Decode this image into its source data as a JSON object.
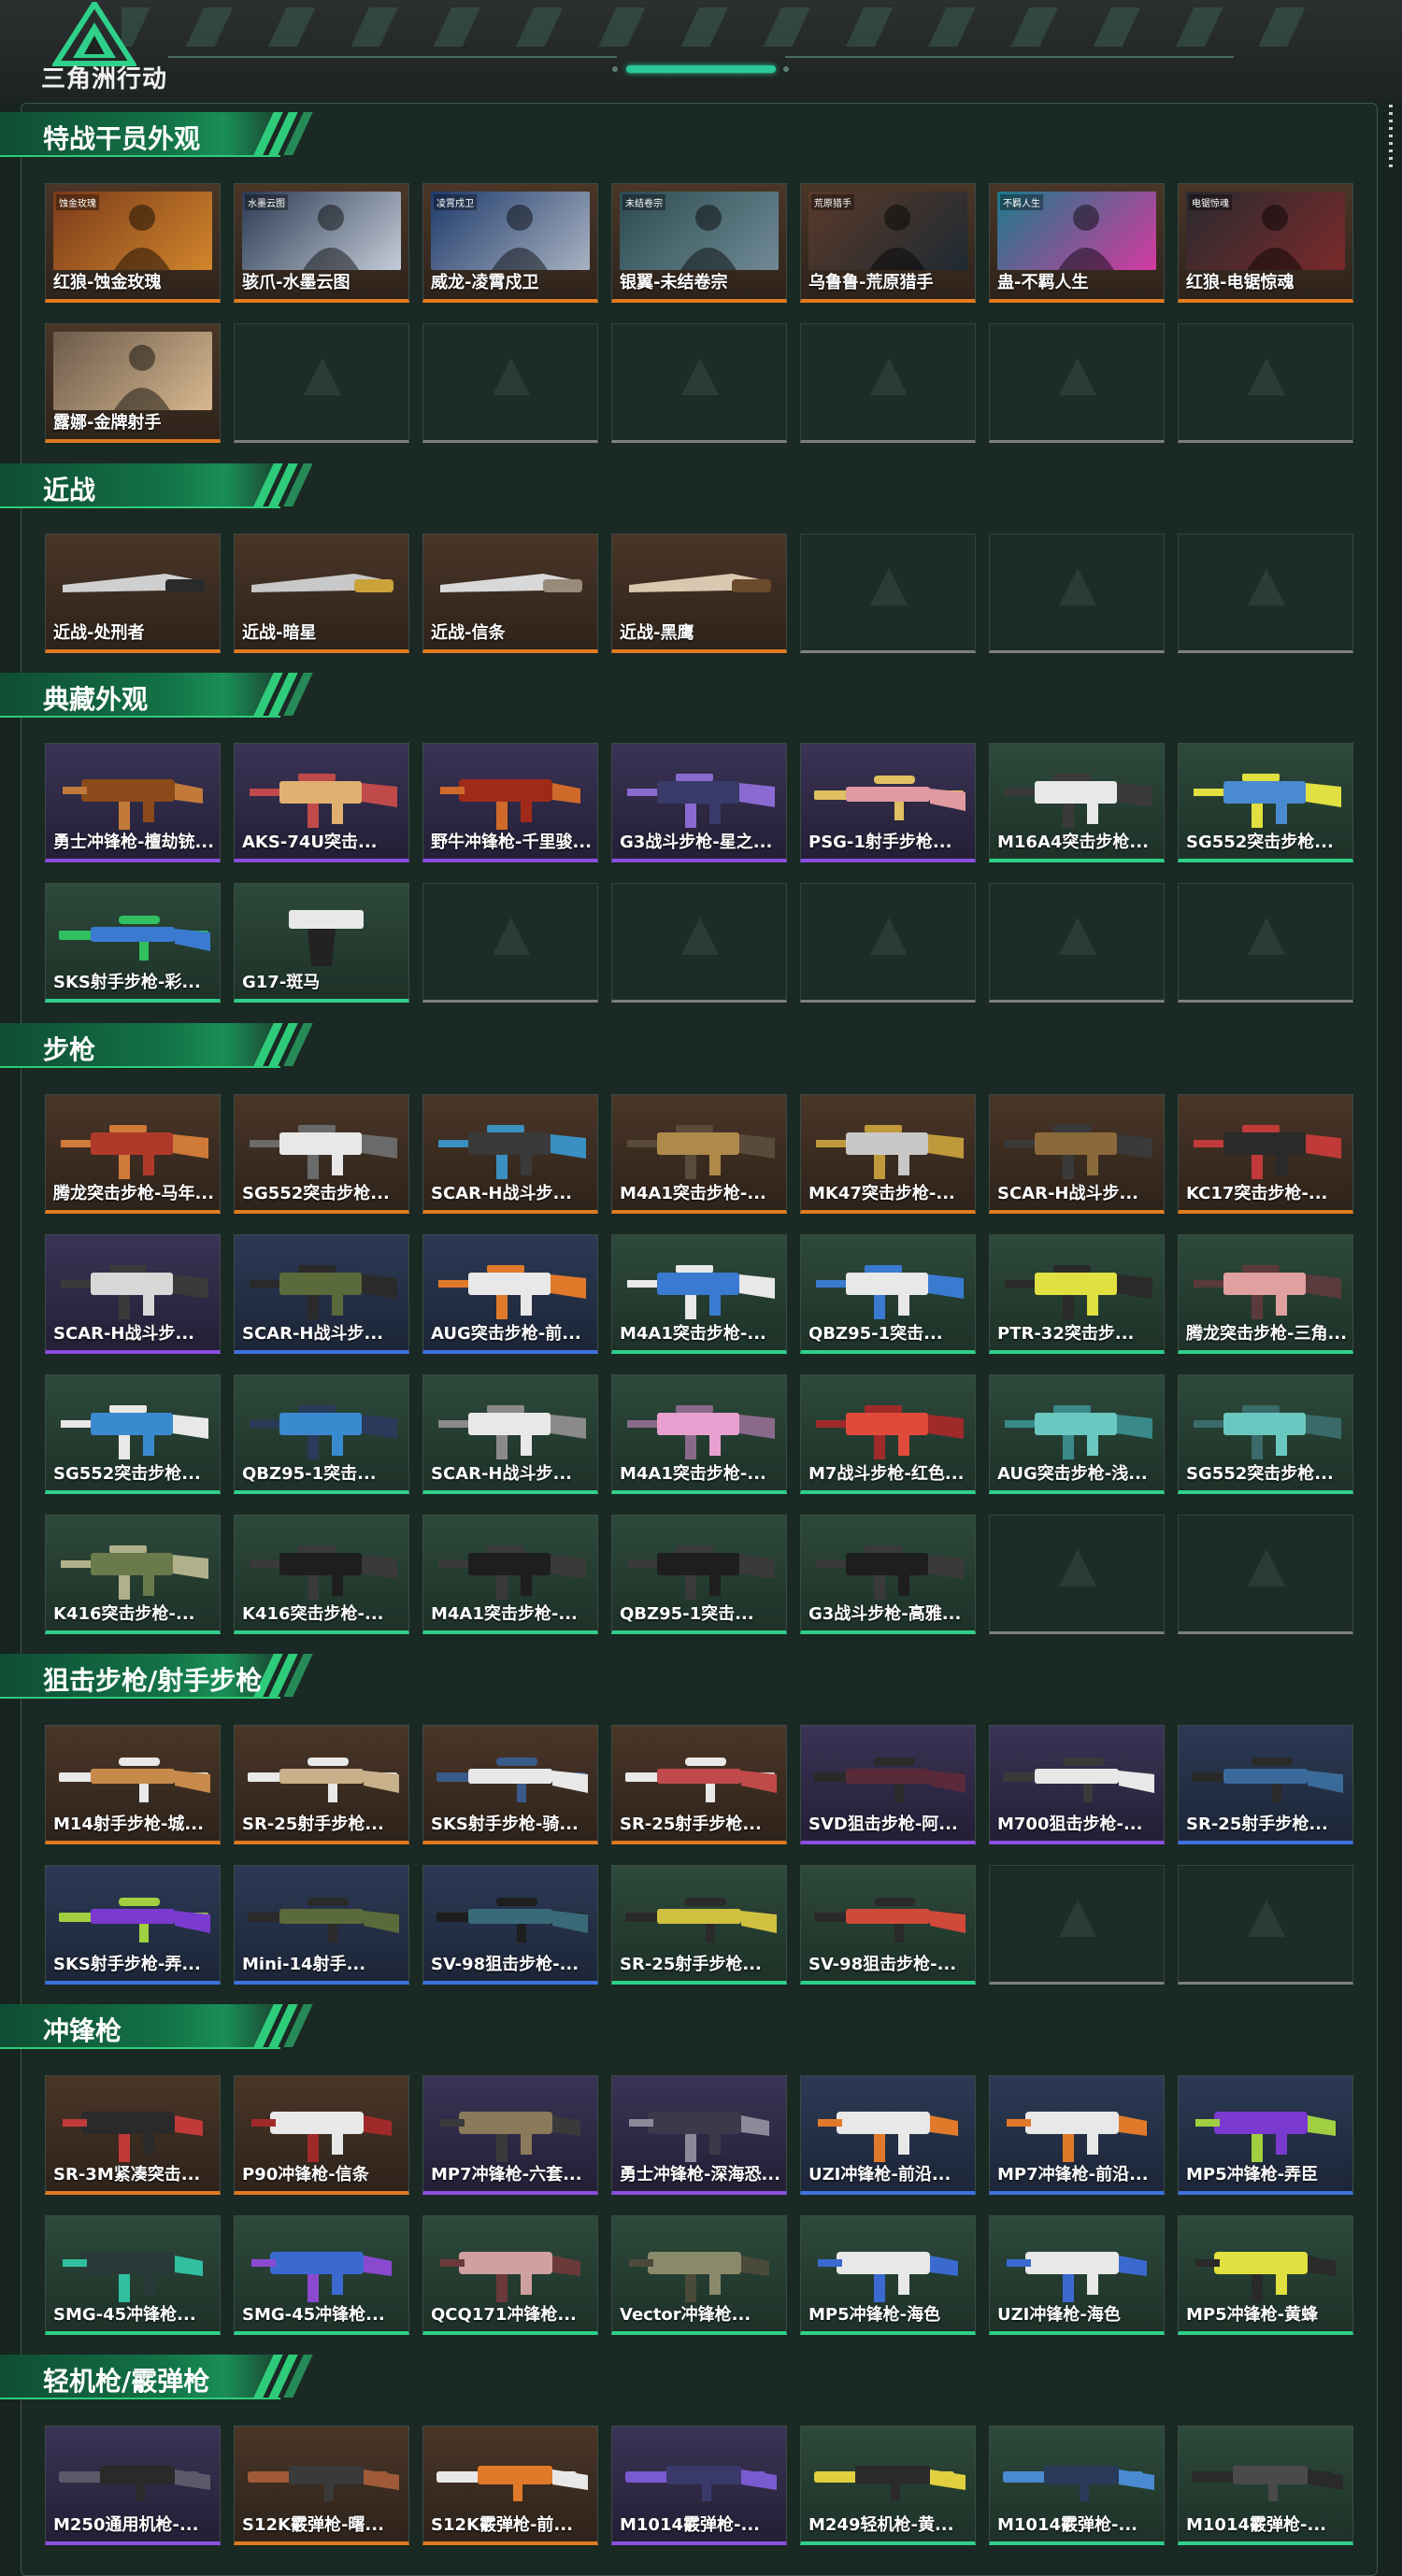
{
  "app": {
    "title": "三角洲行动"
  },
  "sections": [
    {
      "id": "operators",
      "title": "特战干员外观",
      "items": [
        {
          "label": "红狼-蚀金玫瑰",
          "rarity": "orange",
          "icon": "operator-portrait",
          "tag": "蚀金玫瑰",
          "colors": [
            "#7a3a1a",
            "#d2862c"
          ]
        },
        {
          "label": "骇爪-水墨云图",
          "rarity": "orange",
          "icon": "operator-portrait",
          "tag": "水墨云图",
          "colors": [
            "#2b3a52",
            "#c4ccd8"
          ]
        },
        {
          "label": "威龙-凌霄戍卫",
          "rarity": "orange",
          "icon": "operator-portrait",
          "tag": "凌霄戍卫",
          "colors": [
            "#1f3b6b",
            "#a8b2c2"
          ]
        },
        {
          "label": "银翼-未结卷宗",
          "rarity": "orange",
          "icon": "operator-portrait",
          "tag": "未结卷宗",
          "colors": [
            "#2d4a52",
            "#6f8a94"
          ]
        },
        {
          "label": "乌鲁鲁-荒原猎手",
          "rarity": "orange",
          "icon": "operator-portrait",
          "tag": "荒原猎手",
          "colors": [
            "#5a3a2a",
            "#1f2a33"
          ]
        },
        {
          "label": "蛊-不羁人生",
          "rarity": "orange",
          "icon": "operator-portrait",
          "tag": "不羁人生",
          "colors": [
            "#1c7a8a",
            "#d43aa0"
          ]
        },
        {
          "label": "红狼-电锯惊魂",
          "rarity": "orange",
          "icon": "operator-portrait",
          "tag": "电锯惊魂",
          "colors": [
            "#2a2a30",
            "#7a2a2a"
          ]
        },
        {
          "label": "露娜-金牌射手",
          "rarity": "orange",
          "icon": "operator-portrait",
          "tag": "",
          "colors": [
            "#6b5a4a",
            "#d8b890"
          ]
        },
        {
          "empty": true
        },
        {
          "empty": true
        },
        {
          "empty": true
        },
        {
          "empty": true
        },
        {
          "empty": true
        },
        {
          "empty": true
        }
      ]
    },
    {
      "id": "melee",
      "title": "近战",
      "items": [
        {
          "label": "近战-处刑者",
          "rarity": "orange",
          "icon": "knife-icon",
          "colors": [
            "#cfcfcf",
            "#2a2a2a"
          ]
        },
        {
          "label": "近战-暗星",
          "rarity": "orange",
          "icon": "knife-icon",
          "colors": [
            "#c8c8c8",
            "#c9a23a"
          ]
        },
        {
          "label": "近战-信条",
          "rarity": "orange",
          "icon": "knife-icon",
          "colors": [
            "#d8d8d8",
            "#9a8a7a"
          ]
        },
        {
          "label": "近战-黑鹰",
          "rarity": "orange",
          "icon": "knife-icon",
          "colors": [
            "#d8c8b0",
            "#6a4a2a"
          ]
        },
        {
          "empty": true
        },
        {
          "empty": true
        },
        {
          "empty": true
        }
      ]
    },
    {
      "id": "collection",
      "title": "典藏外观",
      "items": [
        {
          "label": "勇士冲锋枪-檀劫铳...",
          "rarity": "purple",
          "icon": "smg-icon",
          "colors": [
            "#8a4a1a",
            "#c27a3a"
          ]
        },
        {
          "label": "AKS-74U突击...",
          "rarity": "purple",
          "icon": "rifle-icon",
          "colors": [
            "#e0b070",
            "#c04a4a"
          ]
        },
        {
          "label": "野牛冲锋枪-千里骏...",
          "rarity": "purple",
          "icon": "smg-icon",
          "colors": [
            "#a02a1a",
            "#d06a2a"
          ]
        },
        {
          "label": "G3战斗步枪-星之...",
          "rarity": "purple",
          "icon": "rifle-icon",
          "colors": [
            "#3a3a6a",
            "#8a6ad0"
          ]
        },
        {
          "label": "PSG-1射手步枪...",
          "rarity": "purple",
          "icon": "sniper-icon",
          "colors": [
            "#e09aa0",
            "#e0c060"
          ]
        },
        {
          "label": "M16A4突击步枪...",
          "rarity": "green",
          "icon": "rifle-icon",
          "colors": [
            "#e8e8e8",
            "#3a3a3a"
          ]
        },
        {
          "label": "SG552突击步枪...",
          "rarity": "green",
          "icon": "rifle-icon",
          "colors": [
            "#4a8ad0",
            "#e0e040"
          ]
        },
        {
          "label": "SKS射手步枪-彩...",
          "rarity": "green",
          "icon": "sniper-icon",
          "colors": [
            "#3a7ad0",
            "#30c060"
          ]
        },
        {
          "label": "G17-斑马",
          "rarity": "green",
          "icon": "pistol-icon",
          "colors": [
            "#e8e8e8",
            "#222222"
          ]
        },
        {
          "empty": true
        },
        {
          "empty": true
        },
        {
          "empty": true
        },
        {
          "empty": true
        },
        {
          "empty": true
        }
      ]
    },
    {
      "id": "rifles",
      "title": "步枪",
      "items": [
        {
          "label": "腾龙突击步枪-马年...",
          "rarity": "orange",
          "icon": "rifle-icon",
          "colors": [
            "#b03a2a",
            "#d07a3a"
          ]
        },
        {
          "label": "SG552突击步枪...",
          "rarity": "orange",
          "icon": "rifle-icon",
          "colors": [
            "#e8e8e8",
            "#6a6a6a"
          ]
        },
        {
          "label": "SCAR-H战斗步...",
          "rarity": "orange",
          "icon": "rifle-icon",
          "colors": [
            "#3a3a3a",
            "#3a90c0"
          ]
        },
        {
          "label": "M4A1突击步枪-...",
          "rarity": "orange",
          "icon": "rifle-icon",
          "colors": [
            "#b08a4a",
            "#5a4a3a"
          ]
        },
        {
          "label": "MK47突击步枪-...",
          "rarity": "orange",
          "icon": "rifle-icon",
          "colors": [
            "#c8c8c8",
            "#c09a3a"
          ]
        },
        {
          "label": "SCAR-H战斗步...",
          "rarity": "orange",
          "icon": "rifle-icon",
          "colors": [
            "#8a6a3a",
            "#3a3a3a"
          ]
        },
        {
          "label": "KC17突击步枪-...",
          "rarity": "orange",
          "icon": "rifle-icon",
          "colors": [
            "#2a2a2a",
            "#c03a3a"
          ]
        },
        {
          "label": "SCAR-H战斗步...",
          "rarity": "purple",
          "icon": "rifle-icon",
          "colors": [
            "#d8d8d8",
            "#3a3a3a"
          ]
        },
        {
          "label": "SCAR-H战斗步...",
          "rarity": "blue",
          "icon": "rifle-icon",
          "colors": [
            "#5a6a3a",
            "#2a2a2a"
          ]
        },
        {
          "label": "AUG突击步枪-前...",
          "rarity": "blue",
          "icon": "rifle-icon",
          "colors": [
            "#e8e8e8",
            "#e07a2a"
          ]
        },
        {
          "label": "M4A1突击步枪-...",
          "rarity": "green",
          "icon": "rifle-icon",
          "colors": [
            "#3a7ad0",
            "#e8e8e8"
          ]
        },
        {
          "label": "QBZ95-1突击...",
          "rarity": "green",
          "icon": "rifle-icon",
          "colors": [
            "#e8e8e8",
            "#3a7ad0"
          ]
        },
        {
          "label": "PTR-32突击步...",
          "rarity": "green",
          "icon": "rifle-icon",
          "colors": [
            "#e0e040",
            "#2a2a2a"
          ]
        },
        {
          "label": "腾龙突击步枪-三角...",
          "rarity": "green",
          "icon": "rifle-icon",
          "colors": [
            "#e0a0a0",
            "#5a3a3a"
          ]
        },
        {
          "label": "SG552突击步枪...",
          "rarity": "green",
          "icon": "rifle-icon",
          "colors": [
            "#3a8ad0",
            "#e8e8e8"
          ]
        },
        {
          "label": "QBZ95-1突击...",
          "rarity": "green",
          "icon": "rifle-icon",
          "colors": [
            "#3a8ad0",
            "#2a3a5a"
          ]
        },
        {
          "label": "SCAR-H战斗步...",
          "rarity": "green",
          "icon": "rifle-icon",
          "colors": [
            "#e8e8e8",
            "#8a8a8a"
          ]
        },
        {
          "label": "M4A1突击步枪-...",
          "rarity": "green",
          "icon": "rifle-icon",
          "colors": [
            "#e8a0d0",
            "#8a6a8a"
          ]
        },
        {
          "label": "M7战斗步枪-红色...",
          "rarity": "green",
          "icon": "rifle-icon",
          "colors": [
            "#e04a3a",
            "#a02a2a"
          ]
        },
        {
          "label": "AUG突击步枪-浅...",
          "rarity": "green",
          "icon": "rifle-icon",
          "colors": [
            "#6ac8c0",
            "#3a8a8a"
          ]
        },
        {
          "label": "SG552突击步枪...",
          "rarity": "green",
          "icon": "rifle-icon",
          "colors": [
            "#6ac8c0",
            "#3a6a6a"
          ]
        },
        {
          "label": "K416突击步枪-...",
          "rarity": "green",
          "icon": "rifle-icon",
          "colors": [
            "#6a7a4a",
            "#b0b08a"
          ]
        },
        {
          "label": "K416突击步枪-...",
          "rarity": "green",
          "icon": "rifle-icon",
          "colors": [
            "#1e1e1e",
            "#3a3a3a"
          ]
        },
        {
          "label": "M4A1突击步枪-...",
          "rarity": "green",
          "icon": "rifle-icon",
          "colors": [
            "#1e1e1e",
            "#3a3a3a"
          ]
        },
        {
          "label": "QBZ95-1突击...",
          "rarity": "green",
          "icon": "rifle-icon",
          "colors": [
            "#1e1e1e",
            "#3a3a3a"
          ]
        },
        {
          "label": "G3战斗步枪-高雅...",
          "rarity": "green",
          "icon": "rifle-icon",
          "colors": [
            "#1e1e1e",
            "#3a3a3a"
          ]
        },
        {
          "empty": true
        },
        {
          "empty": true
        }
      ]
    },
    {
      "id": "marksman",
      "title": "狙击步枪/射手步枪",
      "items": [
        {
          "label": "M14射手步枪-城...",
          "rarity": "orange",
          "icon": "sniper-icon",
          "colors": [
            "#c88a4a",
            "#e8e8e8"
          ]
        },
        {
          "label": "SR-25射手步枪...",
          "rarity": "orange",
          "icon": "sniper-icon",
          "colors": [
            "#c8b08a",
            "#e8e8e8"
          ]
        },
        {
          "label": "SKS射手步枪-骑...",
          "rarity": "orange",
          "icon": "sniper-icon",
          "colors": [
            "#e8e8e8",
            "#3a5a8a"
          ]
        },
        {
          "label": "SR-25射手步枪...",
          "rarity": "orange",
          "icon": "sniper-icon",
          "colors": [
            "#c04a4a",
            "#e8e8e8"
          ]
        },
        {
          "label": "SVD狙击步枪-阿...",
          "rarity": "purple",
          "icon": "sniper-icon",
          "colors": [
            "#5a2a3a",
            "#2a2a2a"
          ]
        },
        {
          "label": "M700狙击步枪-...",
          "rarity": "purple",
          "icon": "sniper-icon",
          "colors": [
            "#e8e8e8",
            "#3a3a3a"
          ]
        },
        {
          "label": "SR-25射手步枪...",
          "rarity": "blue",
          "icon": "sniper-icon",
          "colors": [
            "#3a6a9a",
            "#2a2a2a"
          ]
        },
        {
          "label": "SKS射手步枪-弄...",
          "rarity": "blue",
          "icon": "sniper-icon",
          "colors": [
            "#7a3ad0",
            "#a0d040"
          ]
        },
        {
          "label": "Mini-14射手...",
          "rarity": "blue",
          "icon": "sniper-icon",
          "colors": [
            "#5a6a3a",
            "#2a2a2a"
          ]
        },
        {
          "label": "SV-98狙击步枪-...",
          "rarity": "blue",
          "icon": "sniper-icon",
          "colors": [
            "#3a6a7a",
            "#1e1e1e"
          ]
        },
        {
          "label": "SR-25射手步枪...",
          "rarity": "green",
          "icon": "sniper-icon",
          "colors": [
            "#d0c040",
            "#2a2a2a"
          ]
        },
        {
          "label": "SV-98狙击步枪-...",
          "rarity": "green",
          "icon": "sniper-icon",
          "colors": [
            "#d04a3a",
            "#2a2a2a"
          ]
        },
        {
          "empty": true
        },
        {
          "empty": true
        }
      ]
    },
    {
      "id": "smg",
      "title": "冲锋枪",
      "items": [
        {
          "label": "SR-3M紧凑突击...",
          "rarity": "orange",
          "icon": "smg-icon",
          "colors": [
            "#2a2a2a",
            "#c03a3a"
          ]
        },
        {
          "label": "P90冲锋枪-信条",
          "rarity": "orange",
          "icon": "smg-icon",
          "colors": [
            "#e8e8e8",
            "#a02a2a"
          ]
        },
        {
          "label": "MP7冲锋枪-六套...",
          "rarity": "purple",
          "icon": "smg-icon",
          "colors": [
            "#8a7a5a",
            "#3a3a3a"
          ]
        },
        {
          "label": "勇士冲锋枪-深海恐...",
          "rarity": "purple",
          "icon": "smg-icon",
          "colors": [
            "#3a3a4a",
            "#8a8a9a"
          ]
        },
        {
          "label": "UZI冲锋枪-前沿...",
          "rarity": "blue",
          "icon": "smg-icon",
          "colors": [
            "#e8e8e8",
            "#e07a2a"
          ]
        },
        {
          "label": "MP7冲锋枪-前沿...",
          "rarity": "blue",
          "icon": "smg-icon",
          "colors": [
            "#e8e8e8",
            "#e07a2a"
          ]
        },
        {
          "label": "MP5冲锋枪-弄臣",
          "rarity": "blue",
          "icon": "smg-icon",
          "colors": [
            "#7a3ad0",
            "#a0d040"
          ]
        },
        {
          "label": "SMG-45冲锋枪...",
          "rarity": "green",
          "icon": "smg-icon",
          "colors": [
            "#2a3a3a",
            "#30c0a0"
          ]
        },
        {
          "label": "SMG-45冲锋枪...",
          "rarity": "green",
          "icon": "smg-icon",
          "colors": [
            "#3a6ad0",
            "#8a4ad0"
          ]
        },
        {
          "label": "QCQ171冲锋枪...",
          "rarity": "green",
          "icon": "smg-icon",
          "colors": [
            "#d0a0a0",
            "#6a3a3a"
          ]
        },
        {
          "label": "Vector冲锋枪...",
          "rarity": "green",
          "icon": "smg-icon",
          "colors": [
            "#8a8a6a",
            "#4a4a3a"
          ]
        },
        {
          "label": "MP5冲锋枪-海色",
          "rarity": "green",
          "icon": "smg-icon",
          "colors": [
            "#e8e8e8",
            "#3a6ad0"
          ]
        },
        {
          "label": "UZI冲锋枪-海色",
          "rarity": "green",
          "icon": "smg-icon",
          "colors": [
            "#e8e8e8",
            "#3a6ad0"
          ]
        },
        {
          "label": "MP5冲锋枪-黄蜂",
          "rarity": "green",
          "icon": "smg-icon",
          "colors": [
            "#e0e040",
            "#2a2a2a"
          ]
        }
      ]
    },
    {
      "id": "lmg",
      "title": "轻机枪/霰弹枪",
      "items": [
        {
          "label": "M250通用机枪-...",
          "rarity": "purple",
          "icon": "lmg-icon",
          "colors": [
            "#5a5a6a",
            "#2a2a2a"
          ]
        },
        {
          "label": "S12K霰弹枪-曙...",
          "rarity": "orange",
          "icon": "shotgun-icon",
          "colors": [
            "#a05a3a",
            "#3a3a3a"
          ]
        },
        {
          "label": "S12K霰弹枪-前...",
          "rarity": "orange",
          "icon": "shotgun-icon",
          "colors": [
            "#e8e8e8",
            "#e07a2a"
          ]
        },
        {
          "label": "M1014霰弹枪-...",
          "rarity": "purple",
          "icon": "shotgun-icon",
          "colors": [
            "#7a5ad0",
            "#3a3a6a"
          ]
        },
        {
          "label": "M249轻机枪-黄...",
          "rarity": "green",
          "icon": "lmg-icon",
          "colors": [
            "#e0d040",
            "#2a2a2a"
          ]
        },
        {
          "label": "M1014霰弹枪-...",
          "rarity": "green",
          "icon": "shotgun-icon",
          "colors": [
            "#4a8ad0",
            "#2a3a5a"
          ]
        },
        {
          "label": "M1014霰弹枪-...",
          "rarity": "green",
          "icon": "shotgun-icon",
          "colors": [
            "#2a2a2a",
            "#4a4a4a"
          ]
        }
      ]
    }
  ],
  "rarity_colors": {
    "orange": "#e07a1f",
    "purple": "#8a4fe0",
    "blue": "#3d72e0",
    "green": "#2fd08a",
    "gray": "#8a8f8d"
  }
}
